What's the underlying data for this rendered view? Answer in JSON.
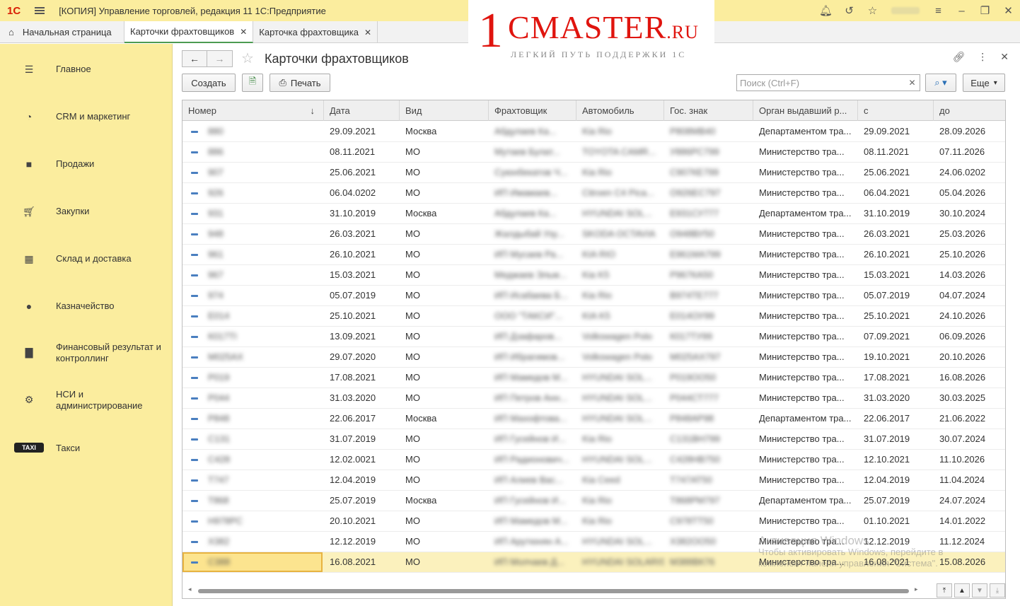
{
  "window": {
    "app_logo": "1С",
    "title": "[КОПИЯ] Управление торговлей, редакция 11 1С:Предприятие"
  },
  "tabs": [
    {
      "label": "Начальная страница"
    },
    {
      "label": "Карточки фрахтовщиков"
    },
    {
      "label": "Карточка фрахтовщика"
    }
  ],
  "sidebar": {
    "items": [
      {
        "label": "Главное",
        "icon": "menu-icon"
      },
      {
        "label": "CRM и маркетинг",
        "icon": "pie-chart-icon"
      },
      {
        "label": "Продажи",
        "icon": "bag-icon"
      },
      {
        "label": "Закупки",
        "icon": "cart-icon"
      },
      {
        "label": "Склад и доставка",
        "icon": "warehouse-icon"
      },
      {
        "label": "Казначейство",
        "icon": "coin-icon"
      },
      {
        "label": "Финансовый результат и контроллинг",
        "icon": "bar-chart-icon"
      },
      {
        "label": "НСИ и администрирование",
        "icon": "gear-icon"
      },
      {
        "label": "Такси",
        "icon": "taxi-icon",
        "badge": "TAXI"
      }
    ]
  },
  "form": {
    "title": "Карточки фрахтовщиков",
    "create_label": "Создать",
    "print_label": "Печать",
    "search_placeholder": "Поиск (Ctrl+F)",
    "more_label": "Еще"
  },
  "table": {
    "columns": [
      "Номер",
      "Дата",
      "Вид",
      "Фрахтовщик",
      "Автомобиль",
      "Гос. знак",
      "Орган выдавший р...",
      "с",
      "до"
    ],
    "rows": [
      {
        "num": "880",
        "date": "29.09.2021",
        "kind": "Москва",
        "carrier": "Абдулаев Ка...",
        "car": "Kia Rio",
        "plate": "Р808МВ40",
        "org": "Департаментом тра...",
        "from": "29.09.2021",
        "to": "28.09.2026"
      },
      {
        "num": "886",
        "date": "08.11.2021",
        "kind": "МО",
        "carrier": "Мутаев Булат...",
        "car": "TOYOTA CAMR...",
        "plate": "У886РС799",
        "org": "Министерство тра...",
        "from": "08.11.2021",
        "to": "07.11.2026"
      },
      {
        "num": "907",
        "date": "25.06.2021",
        "kind": "МО",
        "carrier": "Суюнбекатов Ч...",
        "car": "Kia Rio",
        "plate": "С907КЕ799",
        "org": "Министерство тра...",
        "from": "25.06.2021",
        "to": "24.06.0202"
      },
      {
        "num": "926",
        "date": "06.04.0202",
        "kind": "МО",
        "carrier": "ИП Имамаев...",
        "car": "Citroen C4 Pica...",
        "plate": "О926ЕС797",
        "org": "Министерство тра...",
        "from": "06.04.2021",
        "to": "05.04.2026"
      },
      {
        "num": "931",
        "date": "31.10.2019",
        "kind": "Москва",
        "carrier": "Абдулаев Ка...",
        "car": "HYUNDAI SOL...",
        "plate": "Е931СУ777",
        "org": "Департаментом тра...",
        "from": "31.10.2019",
        "to": "30.10.2024"
      },
      {
        "num": "948",
        "date": "26.03.2021",
        "kind": "МО",
        "carrier": "Жалдыбай Узу...",
        "car": "SKODA OCTAVIA",
        "plate": "О948ВУ50",
        "org": "Министерство тра...",
        "from": "26.03.2021",
        "to": "25.03.2026"
      },
      {
        "num": "961",
        "date": "26.10.2021",
        "kind": "МО",
        "carrier": "ИП Мусаев Ра...",
        "car": "KIA RIO",
        "plate": "Е961МА799",
        "org": "Министерство тра...",
        "from": "26.10.2021",
        "to": "25.10.2026"
      },
      {
        "num": "967",
        "date": "15.03.2021",
        "kind": "МО",
        "carrier": "Меджаев Эльм...",
        "car": "Kia K5",
        "plate": "Р967КА50",
        "org": "Министерство тра...",
        "from": "15.03.2021",
        "to": "14.03.2026"
      },
      {
        "num": "974",
        "date": "05.07.2019",
        "kind": "МО",
        "carrier": "ИП Исабаева Б...",
        "car": "Kia Rio",
        "plate": "В974ТЕ777",
        "org": "Министерство тра...",
        "from": "05.07.2019",
        "to": "04.07.2024"
      },
      {
        "num": "Е014",
        "date": "25.10.2021",
        "kind": "МО",
        "carrier": "ООО \"ТАКСИ\"...",
        "car": "KIA K5",
        "plate": "Е014ОУ99",
        "org": "Министерство тра...",
        "from": "25.10.2021",
        "to": "24.10.2026"
      },
      {
        "num": "К017ТI",
        "date": "13.09.2021",
        "kind": "МО",
        "carrier": "ИП Дзафаров...",
        "car": "Volkswagen Polo",
        "plate": "К017ТУ99",
        "org": "Министерство тра...",
        "from": "07.09.2021",
        "to": "06.09.2026"
      },
      {
        "num": "М025АХ",
        "date": "29.07.2020",
        "kind": "МО",
        "carrier": "ИП Ибрагимов...",
        "car": "Volkswagen Polo",
        "plate": "М025АХ797",
        "org": "Министерство тра...",
        "from": "19.10.2021",
        "to": "20.10.2026"
      },
      {
        "num": "Р019",
        "date": "17.08.2021",
        "kind": "МО",
        "carrier": "ИП Мамедов М...",
        "car": "HYUNDAI SOL...",
        "plate": "Р019ОО50",
        "org": "Министерство тра...",
        "from": "17.08.2021",
        "to": "16.08.2026"
      },
      {
        "num": "Р044",
        "date": "31.03.2020",
        "kind": "МО",
        "carrier": "ИП Петров Анн...",
        "car": "HYUNDAI SOL...",
        "plate": "Р044СТ777",
        "org": "Министерство тра...",
        "from": "31.03.2020",
        "to": "30.03.2025"
      },
      {
        "num": "Р848",
        "date": "22.06.2017",
        "kind": "Москва",
        "carrier": "ИП Махофтова...",
        "car": "HYUNDAI SOL...",
        "plate": "Р848АР98",
        "org": "Департаментом тра...",
        "from": "22.06.2017",
        "to": "21.06.2022"
      },
      {
        "num": "С131",
        "date": "31.07.2019",
        "kind": "МО",
        "carrier": "ИП Гусейнов И...",
        "car": "Kia Rio",
        "plate": "С131ВН799",
        "org": "Министерство тра...",
        "from": "31.07.2019",
        "to": "30.07.2024"
      },
      {
        "num": "С428",
        "date": "12.02.0021",
        "kind": "МО",
        "carrier": "ИП Радионович...",
        "car": "HYUNDAI SOL...",
        "plate": "С428НВ750",
        "org": "Министерство тра...",
        "from": "12.10.2021",
        "to": "11.10.2026"
      },
      {
        "num": "Т747",
        "date": "12.04.2019",
        "kind": "МО",
        "carrier": "ИП Алиев Вас...",
        "car": "Kia Ceed",
        "plate": "Т747АТ50",
        "org": "Министерство тра...",
        "from": "12.04.2019",
        "to": "11.04.2024"
      },
      {
        "num": "Т868",
        "date": "25.07.2019",
        "kind": "Москва",
        "carrier": "ИП Гусейнов И...",
        "car": "Kia Rio",
        "plate": "Т868РМ797",
        "org": "Департаментом тра...",
        "from": "25.07.2019",
        "to": "24.07.2024"
      },
      {
        "num": "Н978РС",
        "date": "20.10.2021",
        "kind": "МО",
        "carrier": "ИП Мамедов М...",
        "car": "Kia Rio",
        "plate": "С978ТТ50",
        "org": "Министерство тра...",
        "from": "01.10.2021",
        "to": "14.01.2022"
      },
      {
        "num": "Х382",
        "date": "12.12.2019",
        "kind": "МО",
        "carrier": "ИП Арутюнян А...",
        "car": "HYUNDAI SOL...",
        "plate": "Х382ОО50",
        "org": "Министерство тра...",
        "from": "12.12.2019",
        "to": "11.12.2024"
      },
      {
        "num": "С388",
        "date": "16.08.2021",
        "kind": "МО",
        "carrier": "ИП Молчаев Д...",
        "car": "HYUNDAI SOLARIS",
        "plate": "М388ВК76",
        "org": "Министерство тра...",
        "from": "16.08.2021",
        "to": "15.08.2026"
      }
    ]
  },
  "watermark": {
    "name": "MASTER",
    "one": "1",
    "C": "C",
    "ru": ".RU",
    "tagline": "ЛЕГКИЙ ПУТЬ ПОДДЕРЖКИ 1С"
  },
  "windows_activation": {
    "line1": "Активация Windows",
    "line2": "Чтобы активировать Windows, перейдите в",
    "line3": "компонент панели управления \"Система\"."
  },
  "colors": {
    "sidebar_bg": "#fbed9e",
    "selected_row": "#fbf1bd",
    "active_tab_underline": "#4c9b52",
    "brand_red": "#e0140e"
  }
}
